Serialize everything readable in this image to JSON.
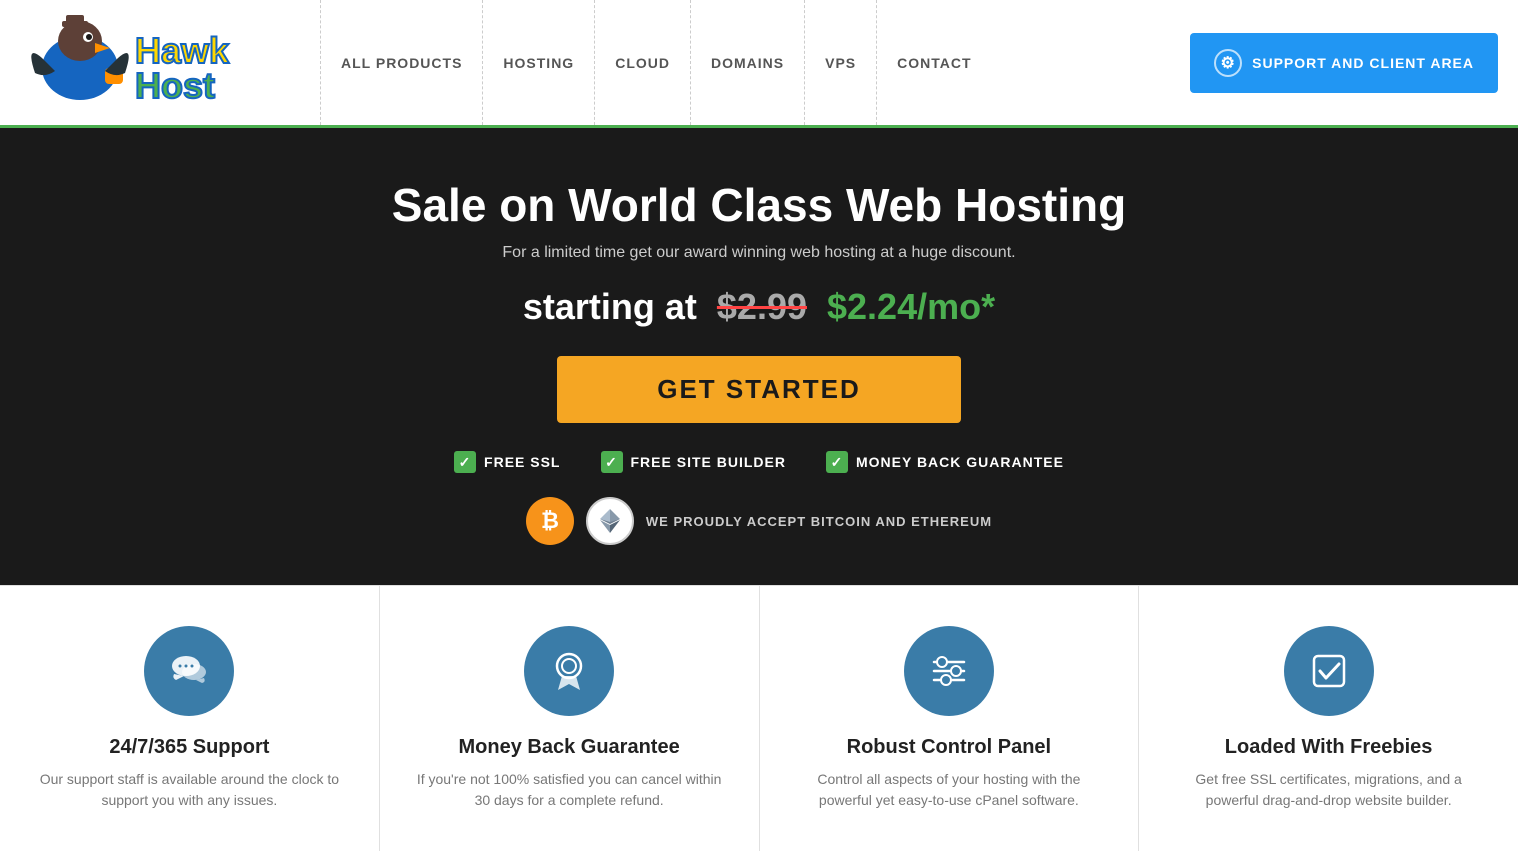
{
  "header": {
    "logo_alt": "HawkHost Logo",
    "nav_items": [
      {
        "label": "ALL PRODUCTS",
        "id": "all-products"
      },
      {
        "label": "HOSTING",
        "id": "hosting"
      },
      {
        "label": "CLOUD",
        "id": "cloud"
      },
      {
        "label": "DOMAINS",
        "id": "domains"
      },
      {
        "label": "VPS",
        "id": "vps"
      },
      {
        "label": "CONTACT",
        "id": "contact"
      }
    ],
    "support_button": "SUPPORT AND CLIENT AREA"
  },
  "hero": {
    "title": "Sale on World Class Web Hosting",
    "subtitle": "For a limited time get our award winning web hosting at a huge discount.",
    "price_prefix": "starting at",
    "old_price": "$2.99",
    "new_price": "$2.24/mo*",
    "cta_button": "GET STARTED",
    "badges": [
      {
        "label": "FREE SSL"
      },
      {
        "label": "FREE SITE BUILDER"
      },
      {
        "label": "MONEY BACK GUARANTEE"
      }
    ],
    "crypto_text": "WE PROUDLY ACCEPT BITCOIN AND ETHEREUM",
    "bitcoin_symbol": "₿",
    "eth_symbol": "Ξ"
  },
  "features": [
    {
      "id": "support",
      "icon": "💬",
      "title": "24/7/365 Support",
      "desc": "Our support staff is available around the clock to support you with any issues."
    },
    {
      "id": "moneyback",
      "icon": "🏅",
      "title": "Money Back Guarantee",
      "desc": "If you're not 100% satisfied you can cancel within 30 days for a complete refund."
    },
    {
      "id": "cpanel",
      "icon": "⚙",
      "title": "Robust Control Panel",
      "desc": "Control all aspects of your hosting with the powerful yet easy-to-use cPanel software."
    },
    {
      "id": "freebies",
      "icon": "✔",
      "title": "Loaded With Freebies",
      "desc": "Get free SSL certificates, migrations, and a powerful drag-and-drop website builder."
    }
  ]
}
